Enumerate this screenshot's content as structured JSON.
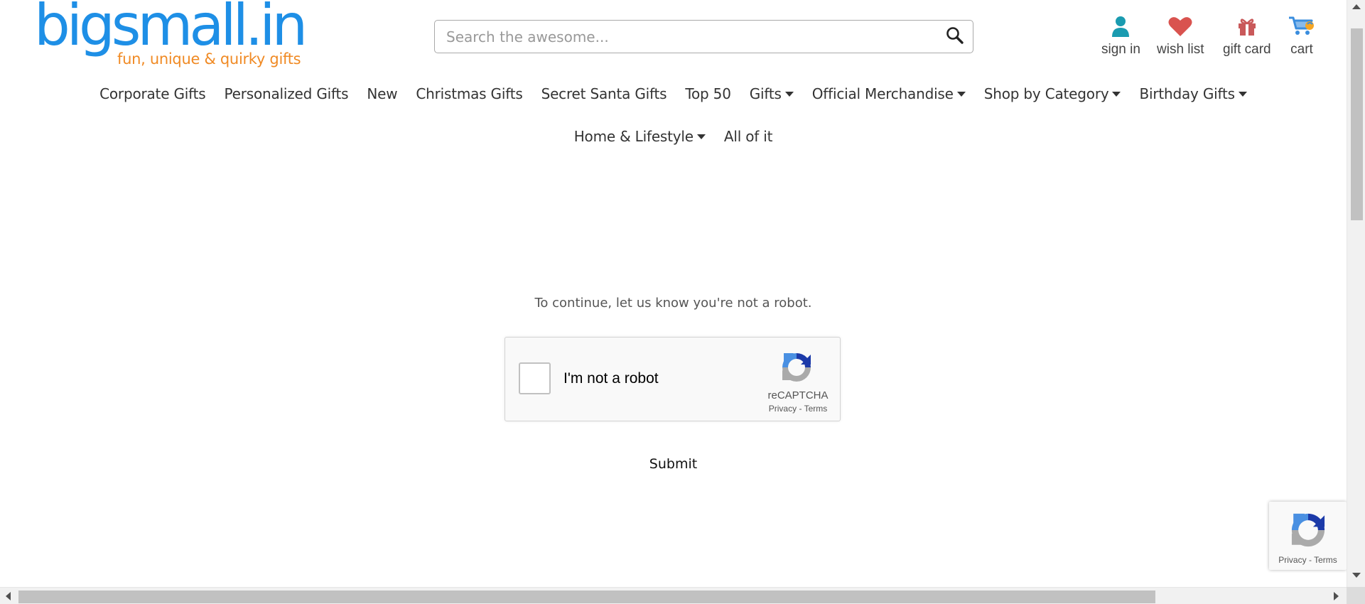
{
  "brand": {
    "name": "bigsmall.in",
    "tagline": "fun, unique & quirky gifts",
    "logo_color": "#1e8fe6",
    "tagline_color": "#f08a24"
  },
  "search": {
    "placeholder": "Search the awesome...",
    "value": "",
    "icon": "search-icon"
  },
  "header_links": [
    {
      "label": "sign in",
      "icon": "user-icon",
      "color": "#1a9bb0"
    },
    {
      "label": "wish list",
      "icon": "heart-icon",
      "color": "#d9534f"
    },
    {
      "label": "gift card",
      "icon": "gift-icon",
      "color": "#c9595a"
    },
    {
      "label": "cart",
      "icon": "cart-icon",
      "color": "#3a8dde"
    }
  ],
  "nav": {
    "row1": [
      {
        "label": "Corporate Gifts",
        "dropdown": false
      },
      {
        "label": "Personalized Gifts",
        "dropdown": false
      },
      {
        "label": "New",
        "dropdown": false
      },
      {
        "label": "Christmas Gifts",
        "dropdown": false
      },
      {
        "label": "Secret Santa Gifts",
        "dropdown": false
      },
      {
        "label": "Top 50",
        "dropdown": false
      },
      {
        "label": "Gifts",
        "dropdown": true
      },
      {
        "label": "Official Merchandise",
        "dropdown": true
      },
      {
        "label": "Shop by Category",
        "dropdown": true
      },
      {
        "label": "Birthday Gifts",
        "dropdown": true
      }
    ],
    "row2": [
      {
        "label": "Home & Lifestyle",
        "dropdown": true
      },
      {
        "label": "All of it",
        "dropdown": false
      }
    ]
  },
  "captcha": {
    "prompt": "To continue, let us know you're not a robot.",
    "checkbox_label": "I'm not a robot",
    "brand": "reCAPTCHA",
    "privacy_label": "Privacy",
    "separator": "-",
    "terms_label": "Terms",
    "submit_label": "Submit"
  },
  "badge": {
    "privacy_label": "Privacy",
    "separator": "-",
    "terms_label": "Terms"
  }
}
